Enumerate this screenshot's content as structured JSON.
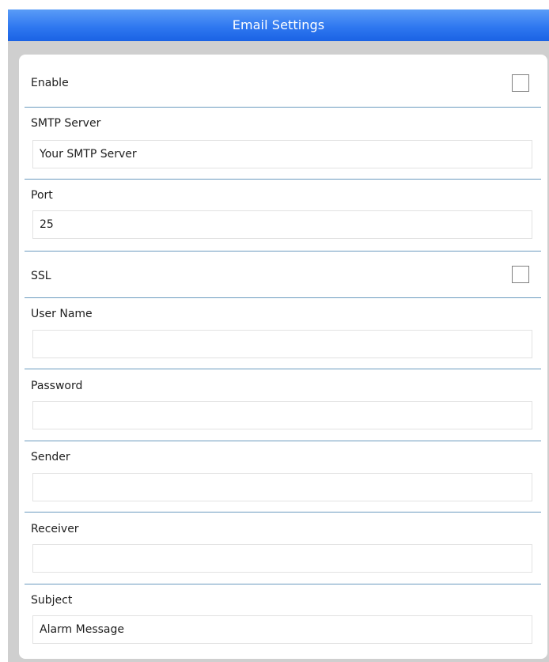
{
  "header": {
    "title": "Email Settings"
  },
  "colors": {
    "titlebar": "#2f78f0",
    "divider": "#6b9bbf",
    "pane": "#cfcfcf"
  },
  "form": {
    "enable": {
      "label": "Enable",
      "checked": false
    },
    "smtp_server": {
      "label": "SMTP Server",
      "value": "Your SMTP Server"
    },
    "port": {
      "label": "Port",
      "value": "25"
    },
    "ssl": {
      "label": "SSL",
      "checked": false
    },
    "user_name": {
      "label": "User Name",
      "value": ""
    },
    "password": {
      "label": "Password",
      "value": ""
    },
    "sender": {
      "label": "Sender",
      "value": ""
    },
    "receiver": {
      "label": "Receiver",
      "value": ""
    },
    "subject": {
      "label": "Subject",
      "value": "Alarm Message"
    }
  }
}
